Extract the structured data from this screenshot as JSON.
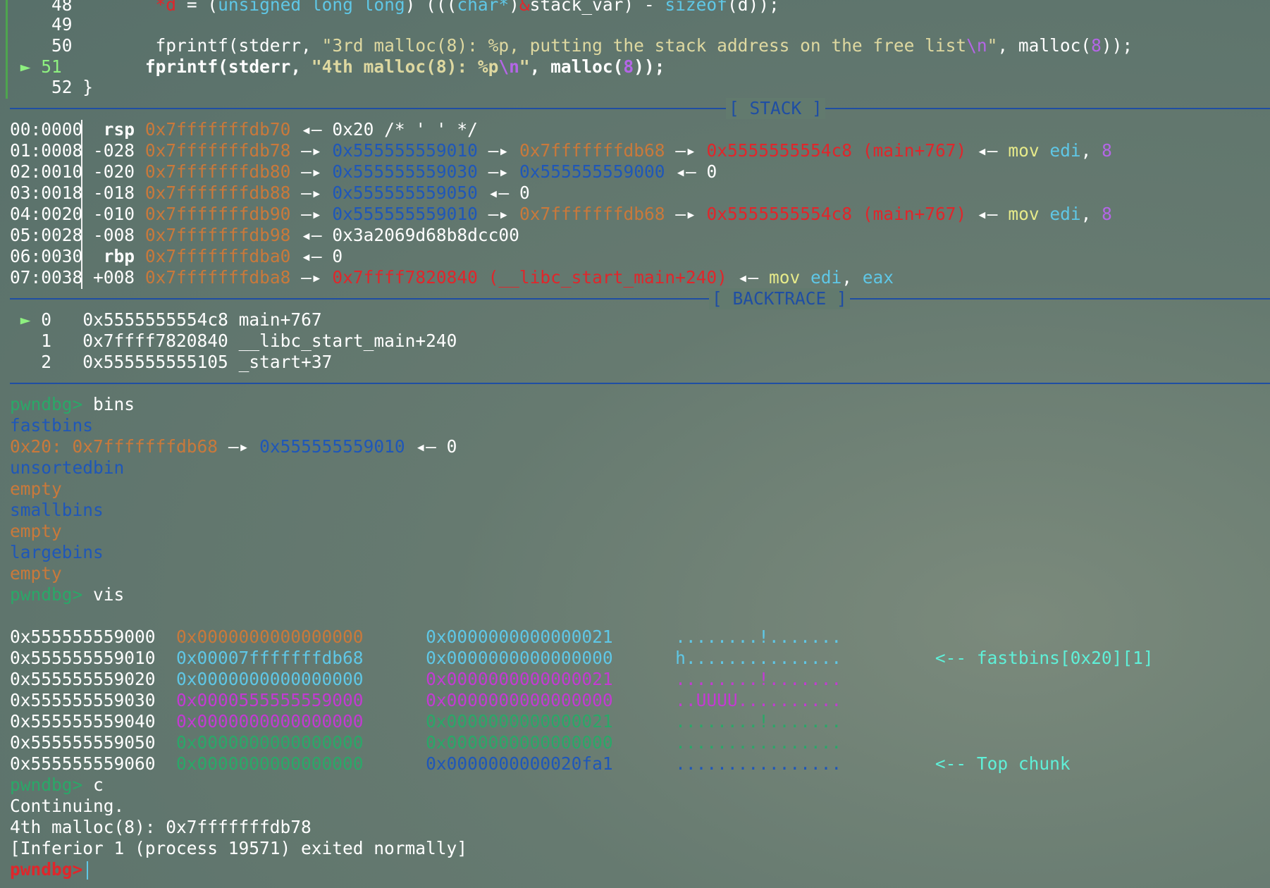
{
  "source": {
    "l48": {
      "num": "48",
      "star": "*d",
      "eq": " = (",
      "kw": "unsigned long long",
      "rest": ") (((",
      "char": "char*",
      "rp": ")",
      "amp": "&",
      "sv": "stack_var) - ",
      "sz": "sizeof",
      "tail": "(d));"
    },
    "l49": {
      "num": "49"
    },
    "l50": {
      "num": "50",
      "fn": "fprintf(stderr, ",
      "str": "\"3rd malloc(8): %p, putting the stack address on the free list",
      "esc": "\\n",
      "q": "\"",
      "mid": ", malloc(",
      "n": "8",
      "end": "));"
    },
    "l51": {
      "arrow": "►",
      "num": "51",
      "fn": "fprintf(stderr, ",
      "str": "\"4th malloc(8): %p",
      "esc": "\\n",
      "q": "\"",
      "mid": ", malloc(",
      "n": "8",
      "end": "));"
    },
    "l52": {
      "num": "52",
      "text": "}"
    }
  },
  "sections": {
    "stack": "[ STACK ]",
    "backtrace": "[ BACKTRACE ]"
  },
  "stack": [
    {
      "idx": "00:0000",
      "reg": "rsp",
      "addr": "0x7fffffffdb70",
      "a1": "◂—",
      "v1": "0x20 /* ' ' */"
    },
    {
      "idx": "01:0008",
      "reg": "-028",
      "addr": "0x7fffffffdb78",
      "a1": "—▸",
      "v1": "0x555555559010",
      "a2": "—▸",
      "v2": "0x7fffffffdb68",
      "a3": "—▸",
      "v3": "0x5555555554c8 (main+767)",
      "a4": "◂—",
      "ins": "mov",
      "op1": "edi",
      "comma": ", ",
      "op2": "8"
    },
    {
      "idx": "02:0010",
      "reg": "-020",
      "addr": "0x7fffffffdb80",
      "a1": "—▸",
      "v1": "0x555555559030",
      "a2": "—▸",
      "v2": "0x555555559000",
      "a3": "◂—",
      "v3": "0"
    },
    {
      "idx": "03:0018",
      "reg": "-018",
      "addr": "0x7fffffffdb88",
      "a1": "—▸",
      "v1": "0x555555559050",
      "a2": "◂—",
      "v2": "0"
    },
    {
      "idx": "04:0020",
      "reg": "-010",
      "addr": "0x7fffffffdb90",
      "a1": "—▸",
      "v1": "0x555555559010",
      "a2": "—▸",
      "v2": "0x7fffffffdb68",
      "a3": "—▸",
      "v3": "0x5555555554c8 (main+767)",
      "a4": "◂—",
      "ins": "mov",
      "op1": "edi",
      "comma": ", ",
      "op2": "8"
    },
    {
      "idx": "05:0028",
      "reg": "-008",
      "addr": "0x7fffffffdb98",
      "a1": "◂—",
      "v1": "0x3a2069d68b8dcc00"
    },
    {
      "idx": "06:0030",
      "reg": "rbp",
      "addr": "0x7fffffffdba0",
      "a1": "◂—",
      "v1": "0"
    },
    {
      "idx": "07:0038",
      "reg": "+008",
      "addr": "0x7fffffffdba8",
      "a1": "—▸",
      "v1": "0x7ffff7820840 (__libc_start_main+240)",
      "a2": "◂—",
      "ins": "mov",
      "op1": "edi",
      "comma": ", ",
      "op2": "eax"
    }
  ],
  "backtrace": [
    {
      "arrow": "►",
      "n": "0",
      "addr": "0x5555555554c8",
      "sym": "main+767"
    },
    {
      "n": "1",
      "addr": "0x7ffff7820840",
      "sym": "__libc_start_main+240"
    },
    {
      "n": "2",
      "addr": "0x555555555105",
      "sym": "_start+37"
    }
  ],
  "prompt": "pwndbg>",
  "cmd_bins": " bins",
  "bins": {
    "fastbins": "fastbins",
    "fb_size": "0x20:",
    "fb_addr": "0x7fffffffdb68",
    "fb_a1": "—▸",
    "fb_v1": "0x555555559010",
    "fb_a2": "◂—",
    "fb_v2": "0",
    "unsorted": "unsortedbin",
    "small": "smallbins",
    "large": "largebins",
    "empty": "empty"
  },
  "cmd_vis": " vis",
  "vis": [
    {
      "addr": "0x555555559000",
      "q1": "0x0000000000000000",
      "q2": "0x0000000000000021",
      "asc": "........!.......",
      "note": ""
    },
    {
      "addr": "0x555555559010",
      "q1": "0x00007fffffffdb68",
      "q2": "0x0000000000000000",
      "asc": "h...............",
      "note": "<-- fastbins[0x20][1]"
    },
    {
      "addr": "0x555555559020",
      "q1": "0x0000000000000000",
      "q2": "0x0000000000000021",
      "asc": "........!.......",
      "note": ""
    },
    {
      "addr": "0x555555559030",
      "q1": "0x0000555555559000",
      "q2": "0x0000000000000000",
      "asc": "..UUUU..........",
      "note": ""
    },
    {
      "addr": "0x555555559040",
      "q1": "0x0000000000000000",
      "q2": "0x0000000000000021",
      "asc": "........!.......",
      "note": ""
    },
    {
      "addr": "0x555555559050",
      "q1": "0x0000000000000000",
      "q2": "0x0000000000000000",
      "asc": "................",
      "note": ""
    },
    {
      "addr": "0x555555559060",
      "q1": "0x0000000000000000",
      "q2": "0x0000000000020fa1",
      "asc": "................",
      "note": "<-- Top chunk"
    }
  ],
  "cmd_c": " c",
  "out": [
    "Continuing.",
    "4th malloc(8): 0x7fffffffdb78",
    "[Inferior 1 (process 19571) exited normally]"
  ],
  "final_prompt": "pwndbg>"
}
